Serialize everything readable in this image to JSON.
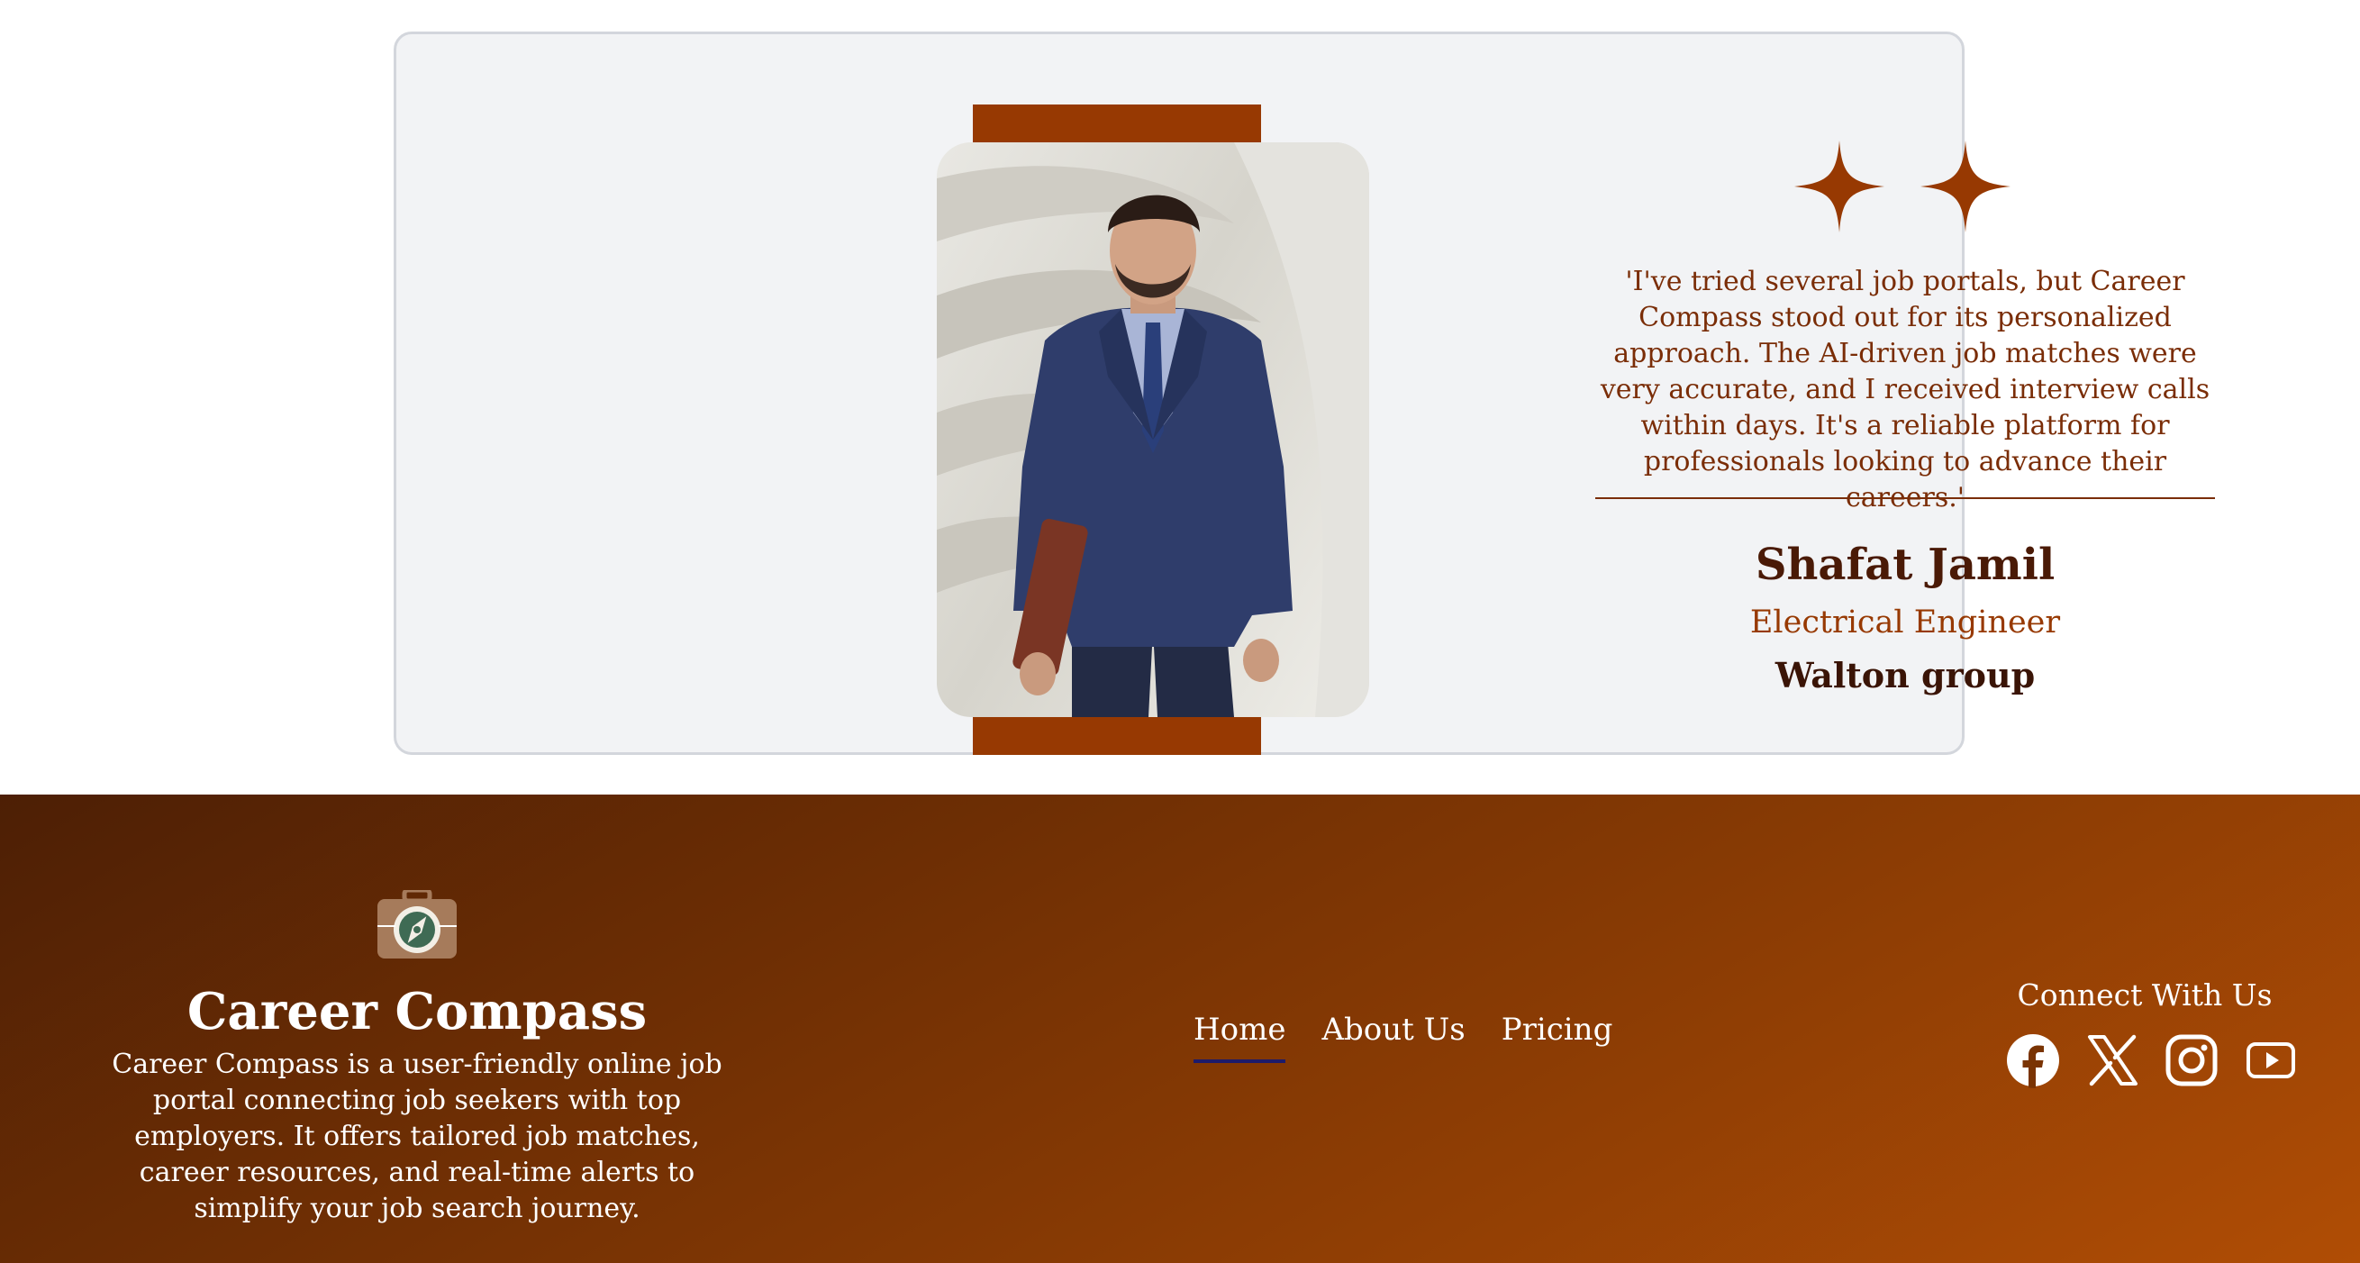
{
  "testimonial": {
    "quote": "'I've tried several job portals, but Career Compass stood out for its personalized approach. The AI-driven job matches were very accurate, and I received interview calls within days. It's a reliable platform for professionals looking to advance their careers.'",
    "name": "Shafat Jamil",
    "role": "Electrical Engineer",
    "company": "Walton group",
    "rating_icons": [
      "sparkle-star-icon",
      "sparkle-star-icon"
    ]
  },
  "footer": {
    "brand": "Career Compass",
    "about": "Career Compass is a user-friendly online job portal connecting job seekers with top employers. It offers tailored job matches, career resources, and real-time alerts to simplify your job search journey.",
    "nav": [
      {
        "label": "Home",
        "active": true
      },
      {
        "label": "About Us",
        "active": false
      },
      {
        "label": "Pricing",
        "active": false
      }
    ],
    "connect_title": "Connect With Us",
    "socials": [
      "facebook-icon",
      "x-twitter-icon",
      "instagram-icon",
      "youtube-icon"
    ]
  },
  "colors": {
    "accent": "#973902",
    "card_bg": "#f2f3f5",
    "footer_gradient_start": "#4d1f05",
    "footer_gradient_end": "#b04d05",
    "active_underline": "#1d1b6b"
  }
}
